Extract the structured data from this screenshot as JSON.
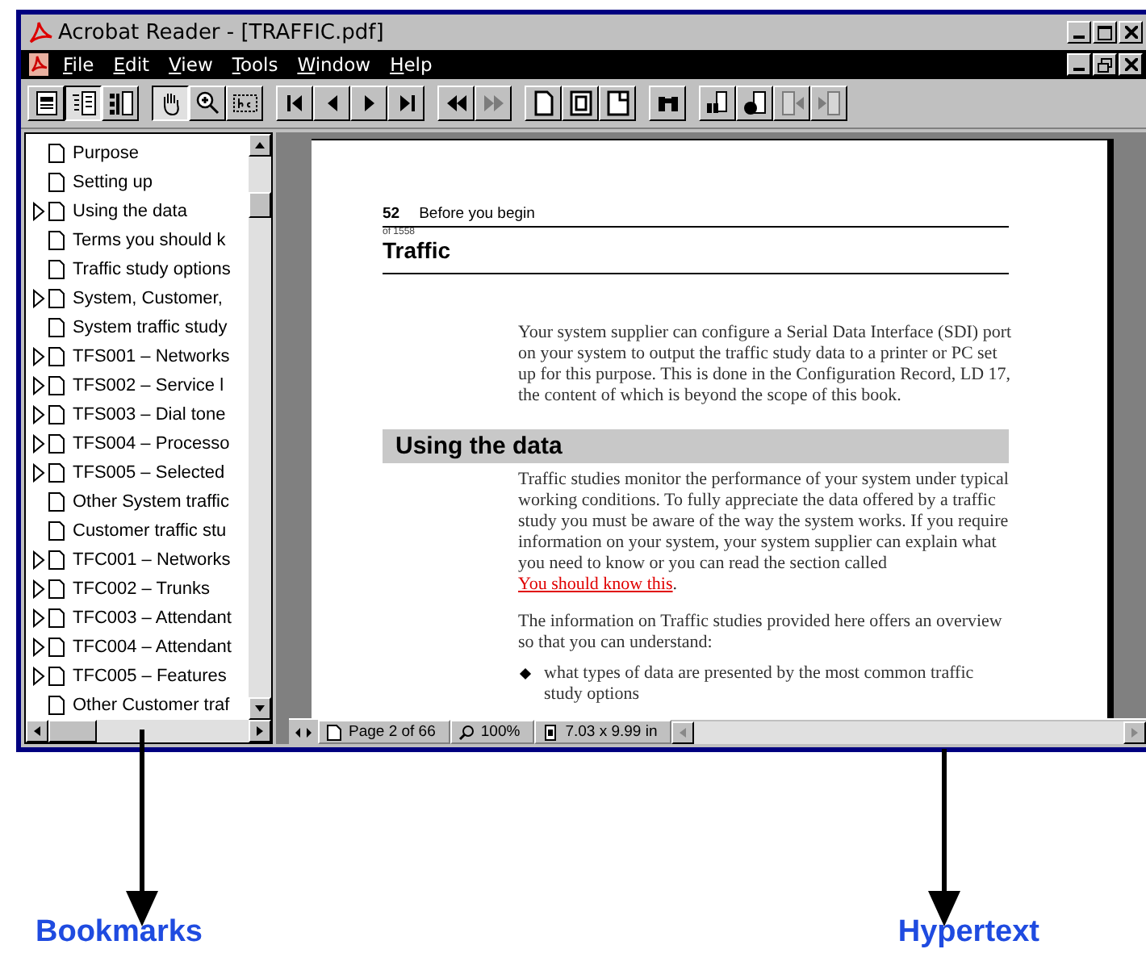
{
  "window": {
    "title": "Acrobat Reader - [TRAFFIC.pdf]"
  },
  "menu": [
    "File",
    "Edit",
    "View",
    "Tools",
    "Window",
    "Help"
  ],
  "toolbar": [
    [
      {
        "kind": "page-only",
        "selected": false,
        "disabled": false
      },
      {
        "kind": "bookmarks-page",
        "selected": true,
        "disabled": false
      },
      {
        "kind": "thumbnails-page",
        "selected": false,
        "disabled": false
      }
    ],
    [
      {
        "kind": "hand",
        "selected": true,
        "disabled": false
      },
      {
        "kind": "zoom-in",
        "selected": false,
        "disabled": false
      },
      {
        "kind": "text-select",
        "selected": false,
        "disabled": false
      }
    ],
    [
      {
        "kind": "first-page",
        "selected": false,
        "disabled": false
      },
      {
        "kind": "previous-page",
        "selected": false,
        "disabled": false
      },
      {
        "kind": "next-page",
        "selected": false,
        "disabled": false
      },
      {
        "kind": "last-page",
        "selected": false,
        "disabled": false
      }
    ],
    [
      {
        "kind": "go-back",
        "selected": false,
        "disabled": false
      },
      {
        "kind": "go-forward",
        "selected": false,
        "disabled": true
      }
    ],
    [
      {
        "kind": "actual-size",
        "selected": false,
        "disabled": false
      },
      {
        "kind": "fit-page",
        "selected": false,
        "disabled": false
      },
      {
        "kind": "fit-width",
        "selected": false,
        "disabled": false
      }
    ],
    [
      {
        "kind": "find",
        "selected": false,
        "disabled": false
      }
    ],
    [
      {
        "kind": "search",
        "selected": false,
        "disabled": false
      },
      {
        "kind": "search-results",
        "selected": false,
        "disabled": false
      },
      {
        "kind": "previous-highlight",
        "selected": false,
        "disabled": true
      },
      {
        "kind": "next-highlight",
        "selected": false,
        "disabled": true
      }
    ]
  ],
  "bookmarks": [
    {
      "label": "Purpose",
      "expandable": false
    },
    {
      "label": "Setting up",
      "expandable": false
    },
    {
      "label": "Using the data",
      "expandable": true
    },
    {
      "label": "Terms you should k",
      "expandable": false
    },
    {
      "label": "Traffic study options",
      "expandable": false
    },
    {
      "label": "System, Customer,",
      "expandable": true
    },
    {
      "label": "System traffic study",
      "expandable": false
    },
    {
      "label": "TFS001 – Networks",
      "expandable": true
    },
    {
      "label": "TFS002 – Service l",
      "expandable": true
    },
    {
      "label": "TFS003 – Dial tone",
      "expandable": true
    },
    {
      "label": "TFS004 – Processo",
      "expandable": true
    },
    {
      "label": "TFS005 – Selected",
      "expandable": true
    },
    {
      "label": "Other System traffic",
      "expandable": false
    },
    {
      "label": "Customer traffic stu",
      "expandable": false
    },
    {
      "label": "TFC001 – Networks",
      "expandable": true
    },
    {
      "label": "TFC002 – Trunks",
      "expandable": true
    },
    {
      "label": "TFC003 – Attendant",
      "expandable": true
    },
    {
      "label": "TFC004 – Attendant",
      "expandable": true
    },
    {
      "label": "TFC005 – Features",
      "expandable": true
    },
    {
      "label": "Other Customer traf",
      "expandable": false
    }
  ],
  "document": {
    "page_number": "52",
    "running_head": "Before you begin",
    "page_of": "of 1558",
    "title": "Traffic",
    "intro": "Your system supplier can configure a Serial Data Interface (SDI) port on your system to output the traffic study data to a printer or PC set up for this purpose. This is done in the Configuration Record, LD 17, the content of which is beyond the scope of this book.",
    "section_heading": "Using the data",
    "paragraph": {
      "text": "Traffic studies monitor the performance of your system under typical working conditions. To fully appreciate the data offered by a traffic study you must be aware of the way the system works. If you require information on your system, your system supplier can explain what you need to know or you can read the section called",
      "link": "You should know this",
      "after": "."
    },
    "paragraph_2": "The information on Traffic studies provided here offers an overview so that you can understand:",
    "bullets": [
      "what types of data are presented by the most common traffic study options"
    ]
  },
  "status_bar": {
    "page": "Page 2 of 66",
    "zoom": "100%",
    "size": "7.03 x 9.99 in"
  },
  "annotations": [
    {
      "label": "Bookmarks"
    },
    {
      "label": "Hypertext"
    }
  ]
}
